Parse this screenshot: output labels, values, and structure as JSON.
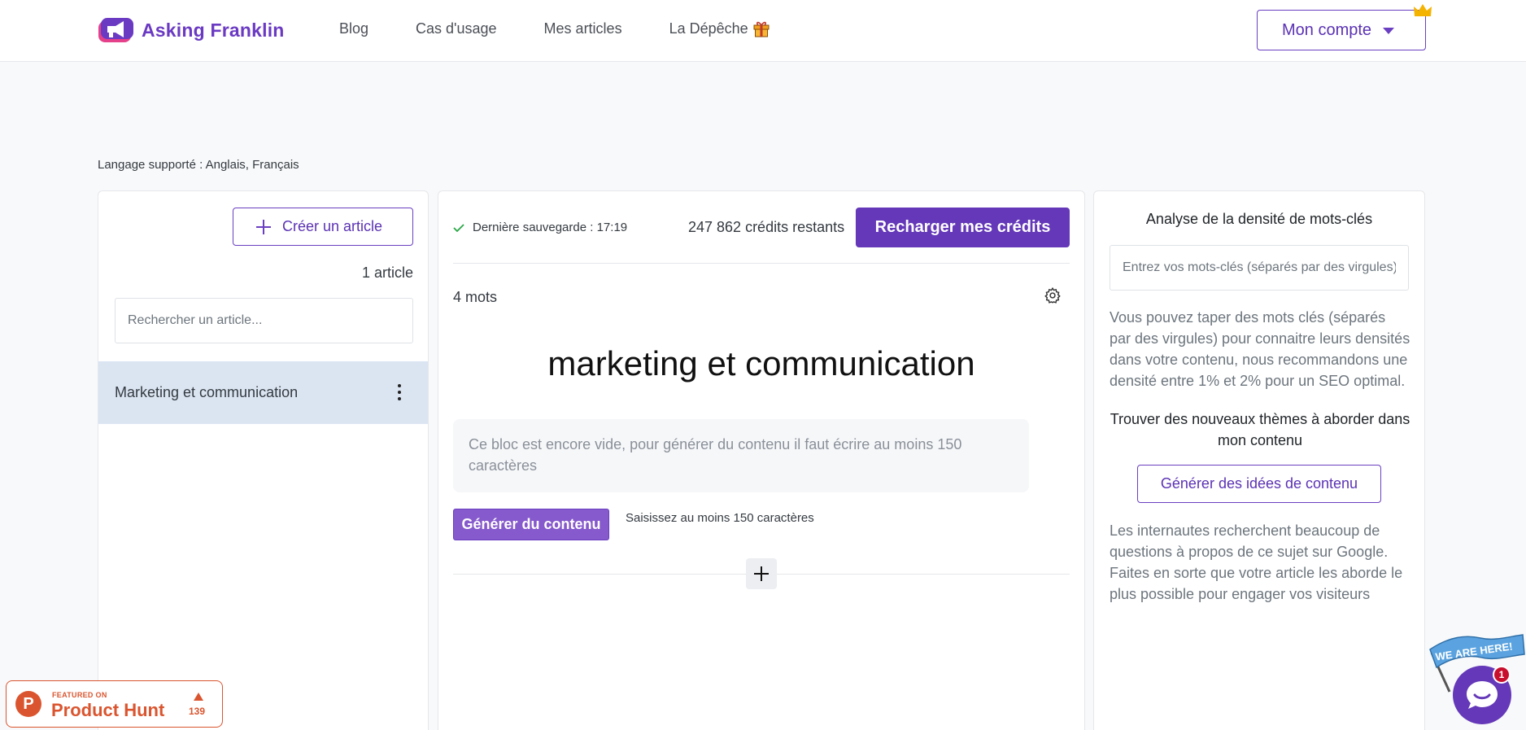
{
  "header": {
    "brand": "Asking Franklin",
    "nav": [
      "Blog",
      "Cas d'usage",
      "Mes articles",
      "La Dépêche"
    ],
    "account_label": "Mon compte"
  },
  "language_note": "Langage supporté : Anglais, Français",
  "left_panel": {
    "create_label": "Créer un article",
    "article_count": "1 article",
    "search_placeholder": "Rechercher un article...",
    "articles": [
      {
        "title": "Marketing et communication"
      }
    ]
  },
  "editor": {
    "save_status": "Dernière sauvegarde : 17:19",
    "credits": "247 862 crédits restants",
    "recharge_label": "Recharger mes crédits",
    "word_count": "4 mots",
    "title": "marketing et communication",
    "empty_block_text": "Ce bloc est encore vide, pour générer du contenu il faut écrire au moins 150 caractères",
    "generate_label": "Générer du contenu",
    "generate_hint": "Saisissez au moins 150 caractères"
  },
  "right_panel": {
    "density_title": "Analyse de la densité de mots-clés",
    "keywords_placeholder": "Entrez vos mots-clés (séparés par des virgules)",
    "density_help": "Vous pouvez taper des mots clés (séparés par des virgules) pour connaitre leurs densités dans votre contenu, nous recommandons une densité entre 1% et 2% pour un SEO optimal.",
    "themes_title": "Trouver des nouveaux thèmes à aborder dans mon contenu",
    "ideas_label": "Générer des idées de contenu",
    "questions_help": "Les internautes recherchent beaucoup de questions à propos de ce sujet sur Google. Faites en sorte que votre article les aborde le plus possible pour engager vos visiteurs"
  },
  "product_hunt": {
    "featured": "FEATURED ON",
    "name": "Product Hunt",
    "votes": "139"
  },
  "chat": {
    "flag_text": "WE ARE HERE!",
    "unread": "1"
  },
  "colors": {
    "brand": "#6438b8",
    "brand_light": "#8659cc",
    "selected_row": "#dbe5f2",
    "product_hunt": "#da552f"
  }
}
